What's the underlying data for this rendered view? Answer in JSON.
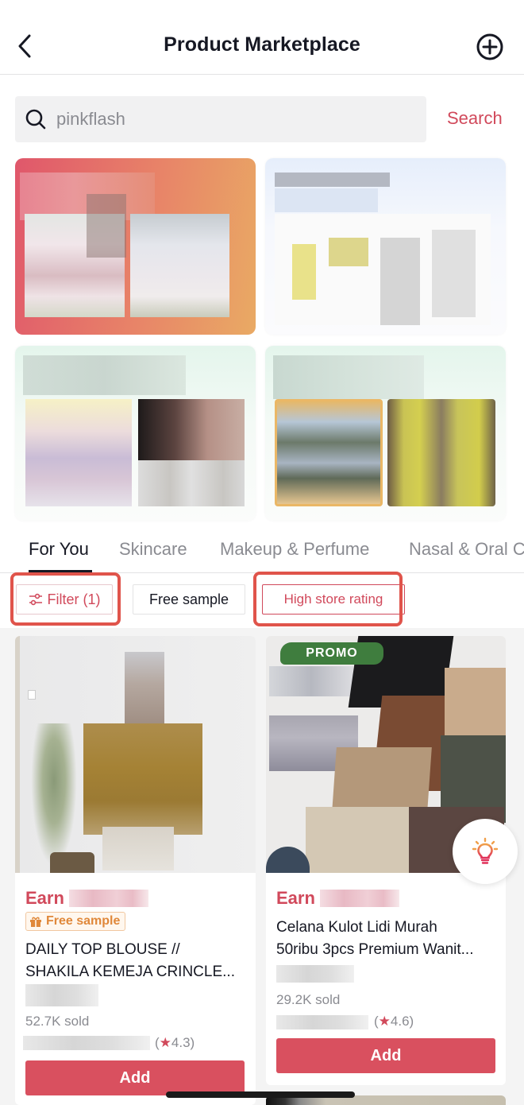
{
  "header": {
    "title": "Product Marketplace",
    "back_icon": "chevron-left-icon",
    "add_icon": "plus-circle-icon"
  },
  "search": {
    "value": "pinkflash",
    "placeholder": "pinkflash",
    "button_label": "Search",
    "icon": "search-icon"
  },
  "banners": [
    {
      "name": "promo-banner-1",
      "blurred": true
    },
    {
      "name": "promo-banner-2",
      "blurred": true
    },
    {
      "name": "promo-banner-3",
      "blurred": true
    },
    {
      "name": "promo-banner-4",
      "blurred": true
    }
  ],
  "tabs": [
    {
      "label": "For You",
      "active": true
    },
    {
      "label": "Skincare",
      "active": false
    },
    {
      "label": "Makeup & Perfume",
      "active": false
    },
    {
      "label": "Nasal & Oral C",
      "active": false
    }
  ],
  "filters": {
    "filter_label": "Filter (1)",
    "free_sample_label": "Free sample",
    "high_rating_label": "High store rating"
  },
  "products": [
    {
      "earn_label": "Earn",
      "earn_value_blurred": true,
      "badge": "Free sample",
      "title_line1": "DAILY TOP BLOUSE //",
      "title_line2": "SHAKILA KEMEJA CRINCLE...",
      "sold": "52.7K sold",
      "rating_open": "(",
      "rating_star": "★",
      "rating_value": "4.3)",
      "add_label": "Add"
    },
    {
      "promo_tag": "PROMO",
      "earn_label": "Earn",
      "earn_value_blurred": true,
      "title_line1": "Celana Kulot Lidi Murah",
      "title_line2": "50ribu 3pcs Premium Wanit...",
      "sold": "29.2K sold",
      "rating_open": "(",
      "rating_star": "★",
      "rating_value": "4.6)",
      "add_label": "Add"
    }
  ],
  "fab": {
    "icon": "lightbulb-icon"
  },
  "colors": {
    "accent": "#d1495b",
    "button": "#d9505f",
    "highlight": "#e0544b",
    "promo": "#3f7d3e",
    "free_badge": "#e0883a"
  }
}
